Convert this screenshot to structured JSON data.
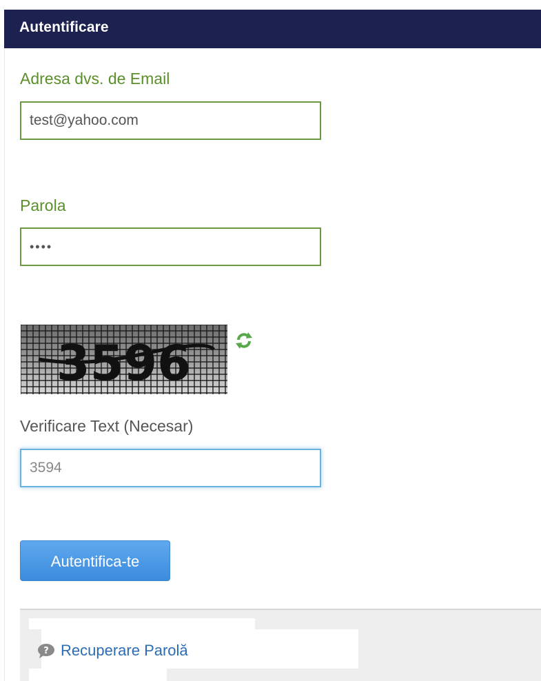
{
  "header": {
    "title": "Autentificare"
  },
  "email": {
    "label": "Adresa dvs. de Email",
    "value": "test@yahoo.com"
  },
  "password": {
    "label": "Parola",
    "value": "••••"
  },
  "captcha": {
    "image_text": "3596",
    "refresh_icon": "refresh-icon",
    "label": "Verificare Text (Necesar)",
    "value": "3594"
  },
  "submit": {
    "label": "Autentifica-te"
  },
  "footer": {
    "recover_label": "Recuperare Parolă",
    "recover_icon": "question-comment-icon"
  },
  "colors": {
    "header_bg": "#1c2150",
    "label_green": "#5b8f2a",
    "button_blue": "#4a9be6",
    "link_blue": "#2a6db5"
  }
}
